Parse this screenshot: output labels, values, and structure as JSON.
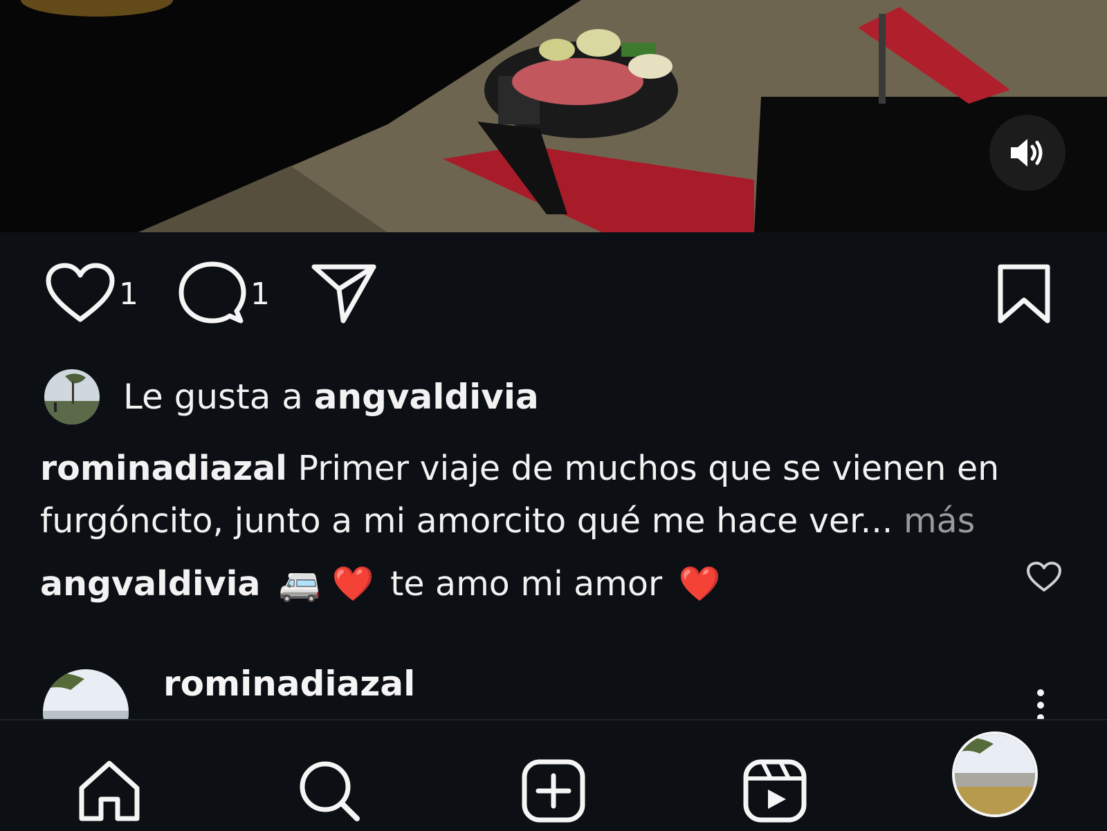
{
  "post": {
    "likes_count": "1",
    "comments_count": "1",
    "liked_by_prefix": "Le gusta a ",
    "liked_by_user": "angvaldivia",
    "caption_user": "rominadiazal",
    "caption_text": " Primer viaje de muchos que se vienen en furgóncito, junto a mi amorcito qué me hace ver...",
    "caption_more": " más",
    "comment_user": "angvaldivia",
    "comment_text_1": "🚐",
    "comment_text_2": "❤️",
    "comment_text_3": " te amo mi amor ",
    "comment_text_4": "❤️"
  },
  "next_post": {
    "username": "rominadiazal"
  },
  "icons": {
    "sound": "speaker-icon",
    "like": "heart-icon",
    "comment": "comment-bubble-icon",
    "share": "paper-plane-icon",
    "save": "bookmark-icon",
    "options": "vertical-dots-icon",
    "nav": [
      "home-icon",
      "search-icon",
      "create-icon",
      "reels-icon",
      "profile-avatar"
    ]
  },
  "colors": {
    "background": "#0c0f14",
    "text": "#f5f5f5",
    "muted": "#9a9a9a"
  }
}
